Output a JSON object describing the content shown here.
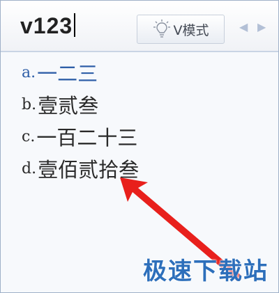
{
  "input": {
    "composition": "v123"
  },
  "toolbar": {
    "mode_label": "V模式"
  },
  "candidates": [
    {
      "index": "a.",
      "text": "一二三",
      "selected": true
    },
    {
      "index": "b.",
      "text": "壹贰叁",
      "selected": false
    },
    {
      "index": "c.",
      "text": "一百二十三",
      "selected": false
    },
    {
      "index": "d.",
      "text": "壹佰贰拾叁",
      "selected": false
    }
  ],
  "watermark": "极速下载站",
  "colors": {
    "selected": "#2f5fa8",
    "arrow": "#e8201c",
    "watermark": "#2d6fbb"
  }
}
